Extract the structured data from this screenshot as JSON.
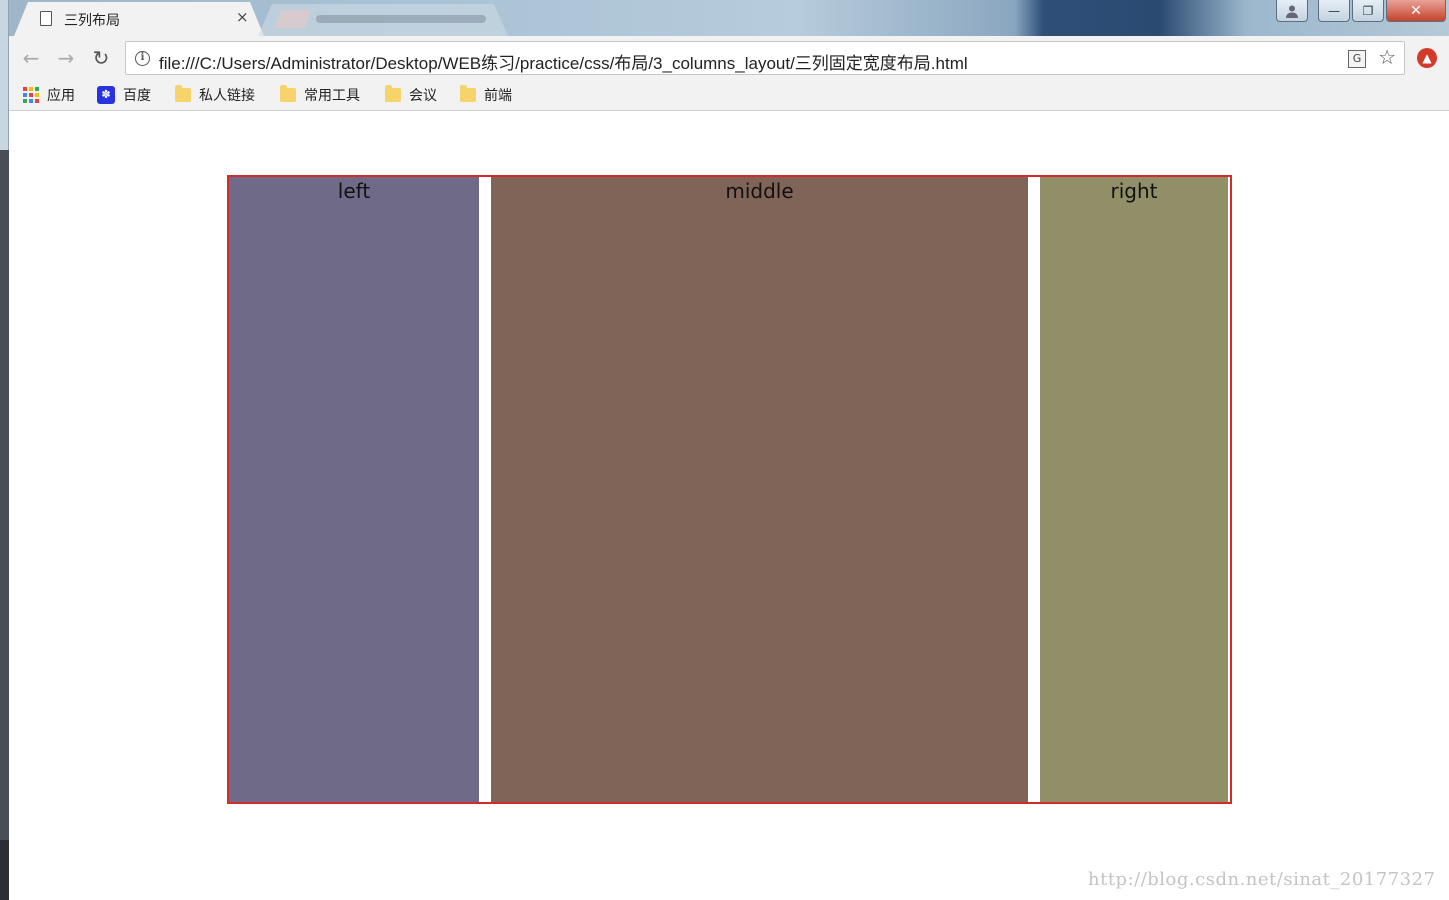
{
  "browser": {
    "active_tab_title": "三列布局",
    "close_tab": "×",
    "url": "file:///C:/Users/Administrator/Desktop/WEB练习/practice/css/布局/3_columns_layout/三列固定宽度布局.html",
    "window_buttons": {
      "minimize": "—",
      "maximize": "❐",
      "close": "✕"
    },
    "nav": {
      "back": "←",
      "forward": "→",
      "reload": "↻"
    },
    "star": "☆"
  },
  "bookmarks": [
    {
      "label": "应用",
      "icon": "apps-grid-icon"
    },
    {
      "label": "百度",
      "icon": "baidu-paw-icon"
    },
    {
      "label": "私人链接",
      "icon": "folder-icon"
    },
    {
      "label": "常用工具",
      "icon": "folder-icon"
    },
    {
      "label": "会议",
      "icon": "folder-icon"
    },
    {
      "label": "前端",
      "icon": "folder-icon"
    }
  ],
  "layout": {
    "left_label": "left",
    "middle_label": "middle",
    "right_label": "right"
  },
  "colors": {
    "border": "#d42a2a",
    "left": "#6f6a88",
    "middle": "#806457",
    "right": "#908f67"
  },
  "watermark": "http://blog.csdn.net/sinat_20177327"
}
